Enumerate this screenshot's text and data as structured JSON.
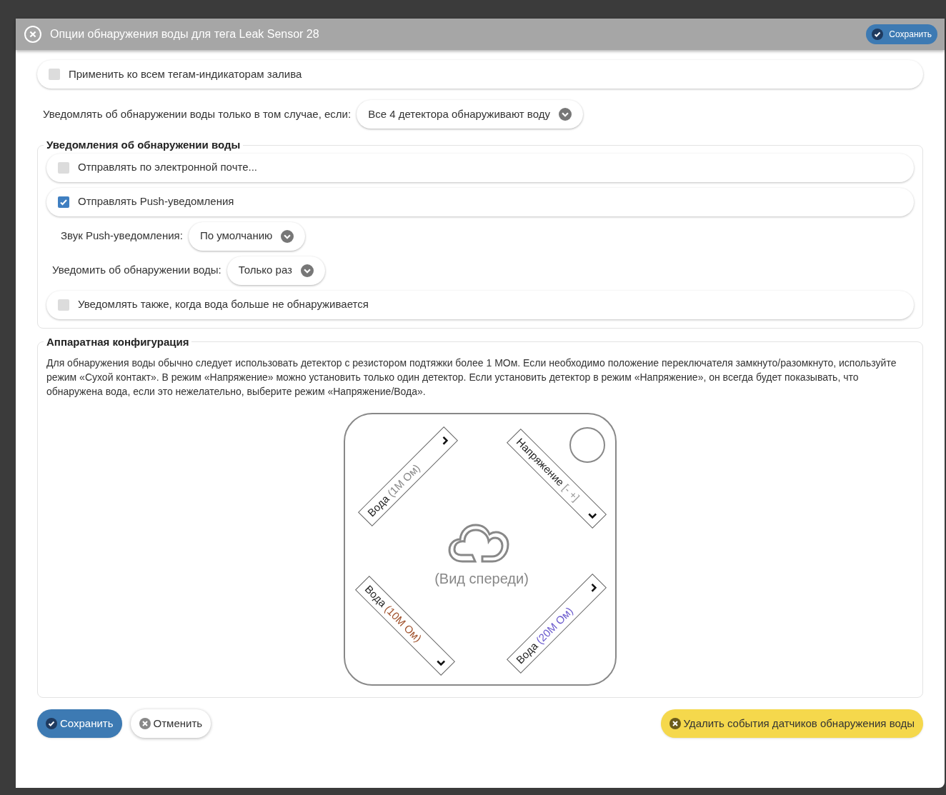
{
  "dialog": {
    "title": "Опции обнаружения воды для тега Leak Sensor 28",
    "header_button": "Сохранить"
  },
  "apply_all": {
    "label": "Применить ко всем тегам-индикаторам залива",
    "checked": false
  },
  "condition": {
    "label": "Уведомлять об обнаружении воды только в том случае, если:",
    "value": "Все 4 детектора обнаруживают воду"
  },
  "notifications": {
    "title": "Уведомления об обнаружении воды",
    "items": [
      {
        "kind": "checkbox",
        "label": "Отправлять по электронной почте...",
        "checked": false
      },
      {
        "kind": "checkbox",
        "label": "Отправлять Push-уведомления",
        "checked": true
      },
      {
        "kind": "select",
        "label": "Звук Push-уведомления:",
        "value": "По умолчанию"
      },
      {
        "kind": "select",
        "label": "Уведомить об обнаружении воды:",
        "value": "Только раз"
      },
      {
        "kind": "checkbox",
        "label": "Уведомлять также, когда вода больше не обнаруживается",
        "checked": false
      }
    ]
  },
  "hardware": {
    "title": "Аппаратная конфигурация",
    "description": "Для обнаружения воды обычно следует использовать детектор с резистором подтяжки более 1 MОм. Если необходимо положение переключателя замкнуто/разомкнуто, используйте режим «Сухой контакт». В режим «Напряжение» можно установить только один детектор. Если установить детектор в режим «Напряжение», он всегда будет показывать, что обнаружена вода, если это нежелательно, выберите режим «Напряжение/Вода».",
    "device_caption": "(Вид спереди)",
    "detectors": [
      {
        "mode": "Вода",
        "value": "(1M Ом)"
      },
      {
        "mode": "Напряжение",
        "value": "[- +]"
      },
      {
        "mode": "Вода",
        "value": "(10M Ом)"
      },
      {
        "mode": "Вода",
        "value": "(20M Ом)"
      }
    ]
  },
  "buttons": {
    "save": "Сохранить",
    "cancel": "Отменить",
    "delete": "Удалить события датчиков обнаружения воды"
  }
}
